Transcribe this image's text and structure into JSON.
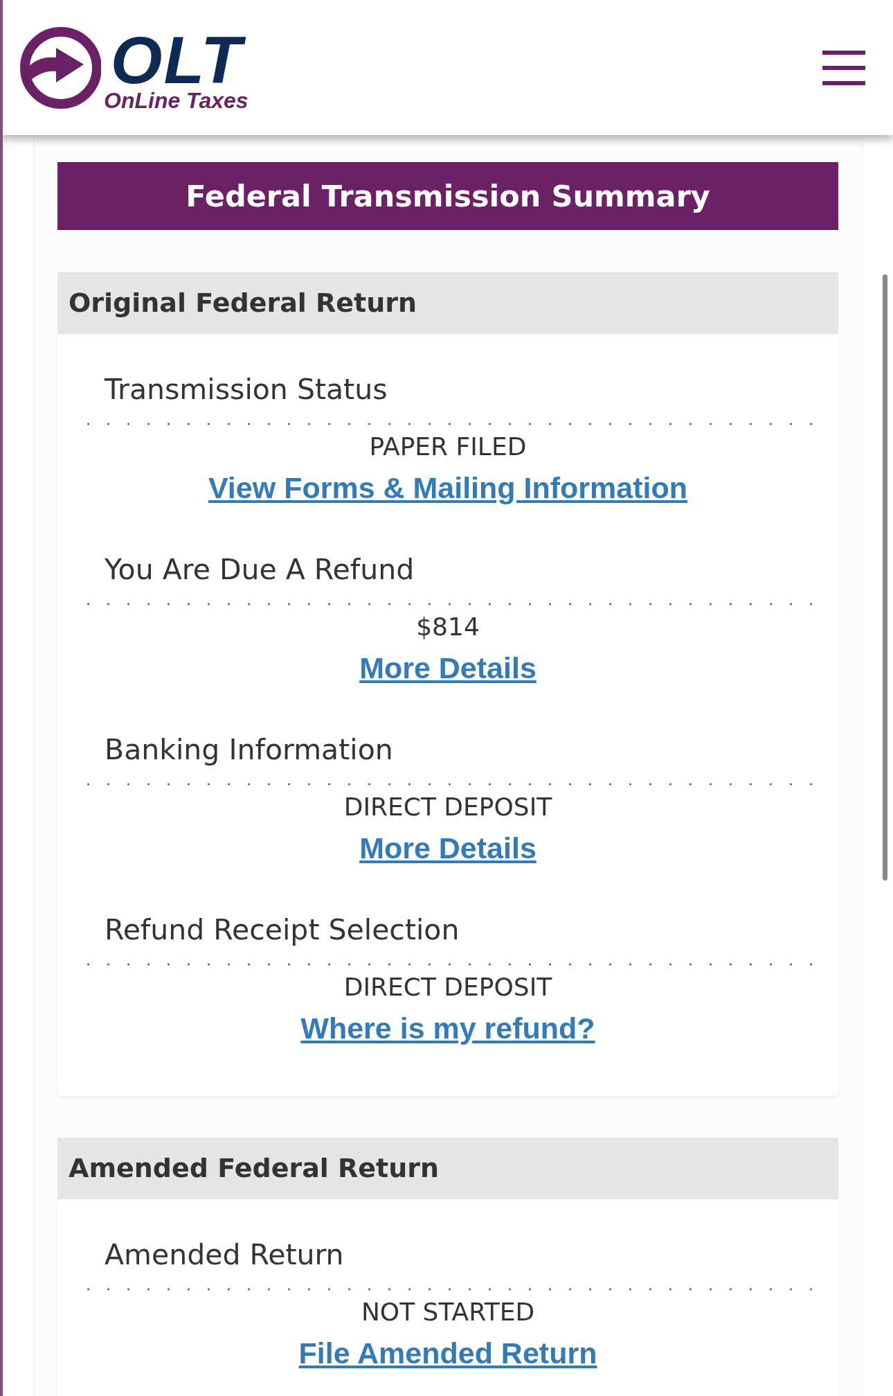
{
  "logo": {
    "mark": "OLT",
    "tagline": "OnLine Taxes"
  },
  "title": "Federal Transmission Summary",
  "sections": [
    {
      "heading": "Original Federal Return",
      "rows": [
        {
          "label": "Transmission Status",
          "value": "PAPER FILED",
          "link": "View Forms & Mailing Information"
        },
        {
          "label": "You Are Due A Refund",
          "value": "$814",
          "link": "More Details"
        },
        {
          "label": "Banking Information",
          "value": "DIRECT DEPOSIT",
          "link": "More Details"
        },
        {
          "label": "Refund Receipt Selection",
          "value": "DIRECT DEPOSIT",
          "link": "Where is my refund?"
        }
      ]
    },
    {
      "heading": "Amended Federal Return",
      "rows": [
        {
          "label": "Amended Return",
          "value": "NOT STARTED",
          "link": "File Amended Return"
        }
      ]
    }
  ]
}
